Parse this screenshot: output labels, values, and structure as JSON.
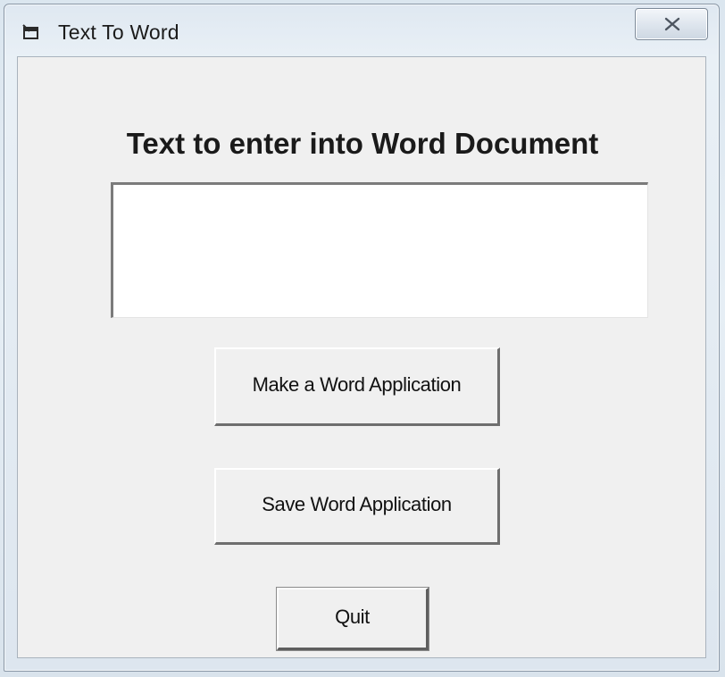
{
  "window": {
    "title": "Text To Word",
    "icon": "app-window-icon",
    "close_icon": "close-x-icon"
  },
  "form": {
    "heading": "Text to enter into Word Document",
    "text_input": {
      "value": "",
      "placeholder": ""
    },
    "buttons": {
      "make_label": "Make a Word Application",
      "save_label": "Save Word Application",
      "quit_label": "Quit"
    }
  },
  "colors": {
    "dialog_background": "#f0f0f0",
    "title_bar": "#e2eaf2",
    "text_color": "#1a1a1a"
  }
}
